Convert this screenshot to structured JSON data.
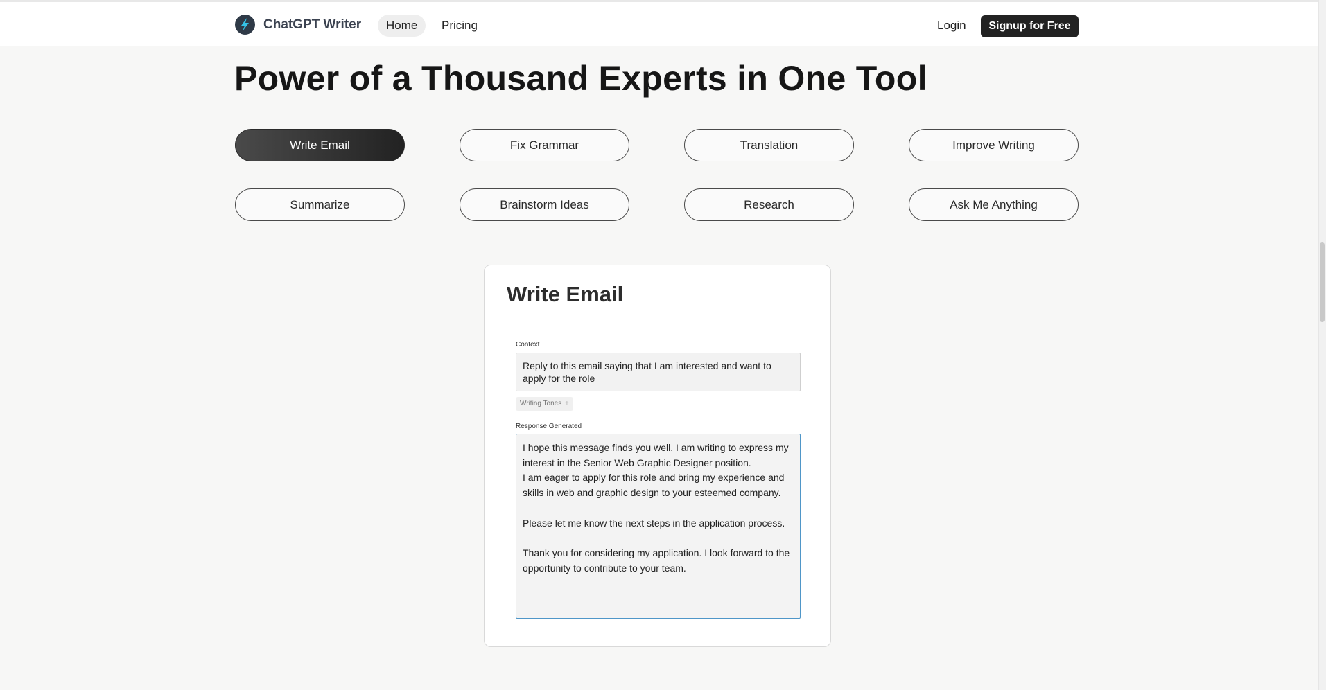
{
  "header": {
    "brand": "ChatGPT Writer",
    "nav": {
      "home": "Home",
      "pricing": "Pricing"
    },
    "login": "Login",
    "signup": "Signup for Free",
    "logo_icon": "lightning-bolt-icon"
  },
  "hero": {
    "headline": "Power of a Thousand Experts in One Tool"
  },
  "tools": [
    {
      "label": "Write Email",
      "active": true
    },
    {
      "label": "Fix Grammar",
      "active": false
    },
    {
      "label": "Translation",
      "active": false
    },
    {
      "label": "Improve Writing",
      "active": false
    },
    {
      "label": "Summarize",
      "active": false
    },
    {
      "label": "Brainstorm Ideas",
      "active": false
    },
    {
      "label": "Research",
      "active": false
    },
    {
      "label": "Ask Me Anything",
      "active": false
    }
  ],
  "demo": {
    "title": "Write Email",
    "context_label": "Context",
    "context_value": "Reply to this email saying that I am interested and want to apply for the role",
    "tones_label": "Writing Tones",
    "tones_icon": "plus-icon",
    "response_label": "Response Generated",
    "response": {
      "p1": "I hope this message finds you well. I am writing to express my interest in the Senior Web Graphic Designer position.",
      "p2": "I am eager to apply for this role and bring my experience and skills in web and graphic design to your esteemed company.",
      "p3": "Please let me know the next steps in the application process.",
      "p4": "Thank you for considering my application. I look forward to the opportunity to contribute to your team."
    }
  },
  "colors": {
    "accent_dark": "#222222",
    "logo_bg": "#2f3a47",
    "logo_bolt": "#35c2e6",
    "focus_border": "#4f96c8"
  }
}
